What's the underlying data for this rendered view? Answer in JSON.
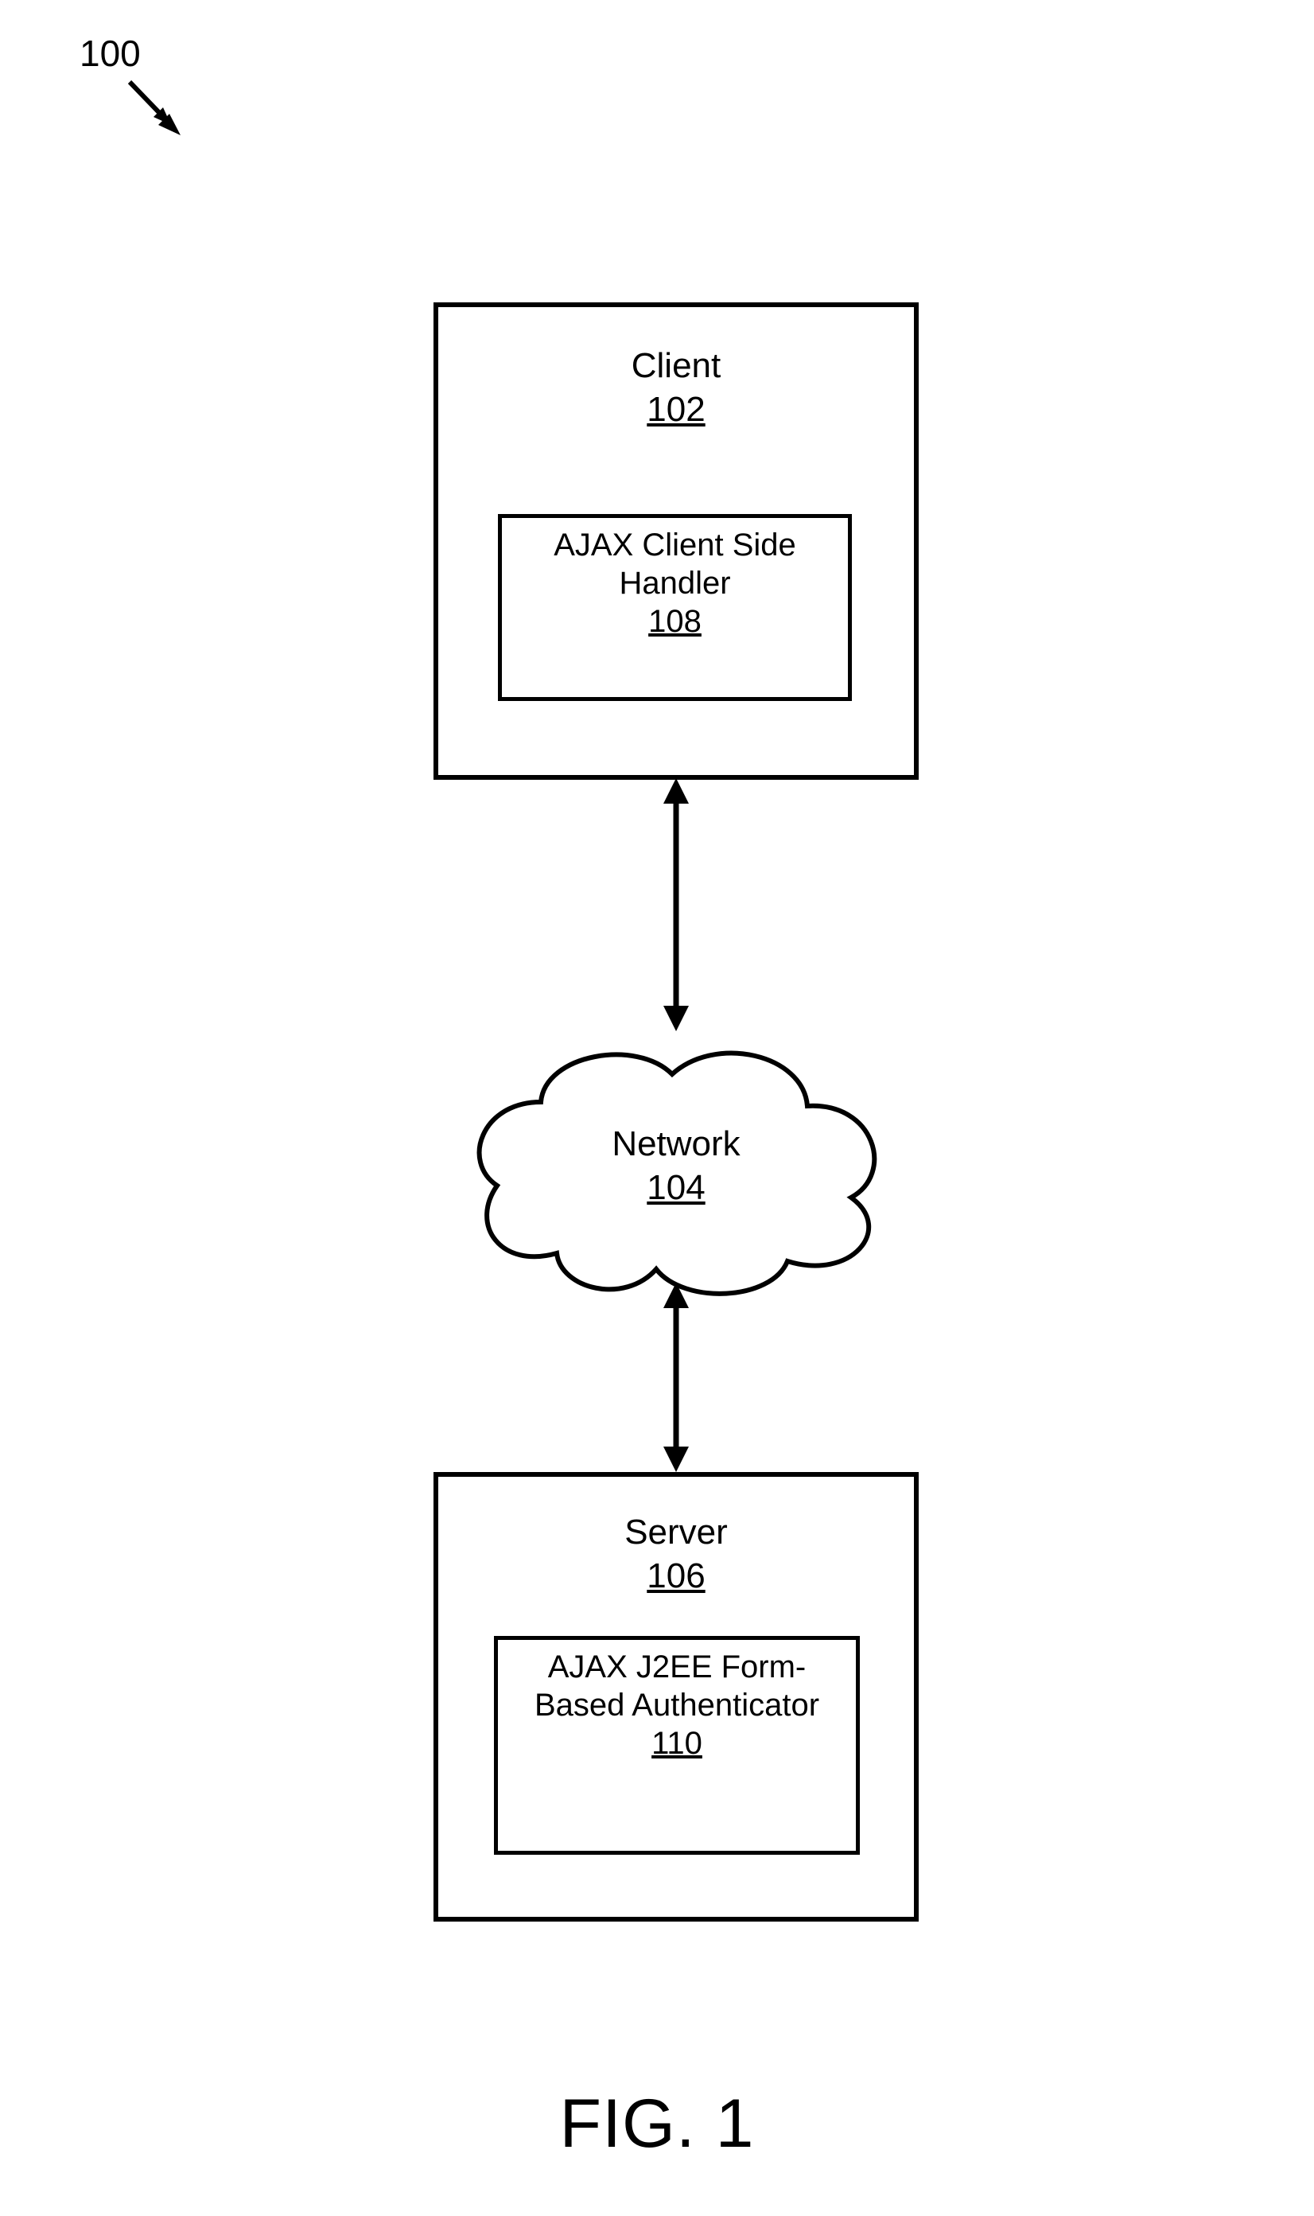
{
  "diagramRef": "100",
  "client": {
    "title": "Client",
    "num": "102",
    "handler": {
      "title": "AJAX Client Side Handler",
      "num": "108"
    }
  },
  "network": {
    "title": "Network",
    "num": "104"
  },
  "server": {
    "title": "Server",
    "num": "106",
    "authenticator": {
      "title": "AJAX J2EE Form-Based Authenticator",
      "num": "110"
    }
  },
  "figureCaption": "FIG. 1"
}
